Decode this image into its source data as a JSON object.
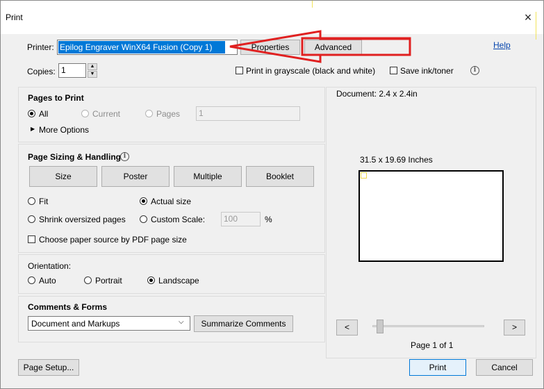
{
  "window": {
    "title": "Print",
    "close_icon": "×"
  },
  "printer": {
    "label": "Printer:",
    "selected": "Epilog Engraver WinX64 Fusion (Copy 1)",
    "properties_label": "Properties",
    "advanced_label": "Advanced",
    "help_label": "Help"
  },
  "copies": {
    "label": "Copies:",
    "value": "1"
  },
  "options": {
    "grayscale_label": "Print in grayscale (black and white)",
    "save_ink_label": "Save ink/toner"
  },
  "pages_to_print": {
    "heading": "Pages to Print",
    "all_label": "All",
    "current_label": "Current",
    "pages_label": "Pages",
    "pages_value": "1",
    "more_options_label": "More Options"
  },
  "sizing": {
    "heading": "Page Sizing & Handling",
    "size_label": "Size",
    "poster_label": "Poster",
    "multiple_label": "Multiple",
    "booklet_label": "Booklet",
    "fit_label": "Fit",
    "actual_size_label": "Actual size",
    "shrink_label": "Shrink oversized pages",
    "custom_scale_label": "Custom Scale:",
    "custom_scale_value": "100",
    "percent": "%",
    "paper_source_label": "Choose paper source by PDF page size"
  },
  "orientation": {
    "heading": "Orientation:",
    "auto_label": "Auto",
    "portrait_label": "Portrait",
    "landscape_label": "Landscape"
  },
  "comments": {
    "heading": "Comments & Forms",
    "selected": "Document and Markups",
    "summarize_label": "Summarize Comments"
  },
  "preview": {
    "document_size": "Document: 2.4 x 2.4in",
    "page_size": "31.5 x 19.69 Inches",
    "prev": "<",
    "next": ">",
    "page_indicator": "Page 1 of 1"
  },
  "footer": {
    "page_setup_label": "Page Setup...",
    "print_label": "Print",
    "cancel_label": "Cancel"
  },
  "colors": {
    "annotation_red": "#e02020",
    "selection_blue": "#0078d7",
    "link_blue": "#0645ad"
  }
}
